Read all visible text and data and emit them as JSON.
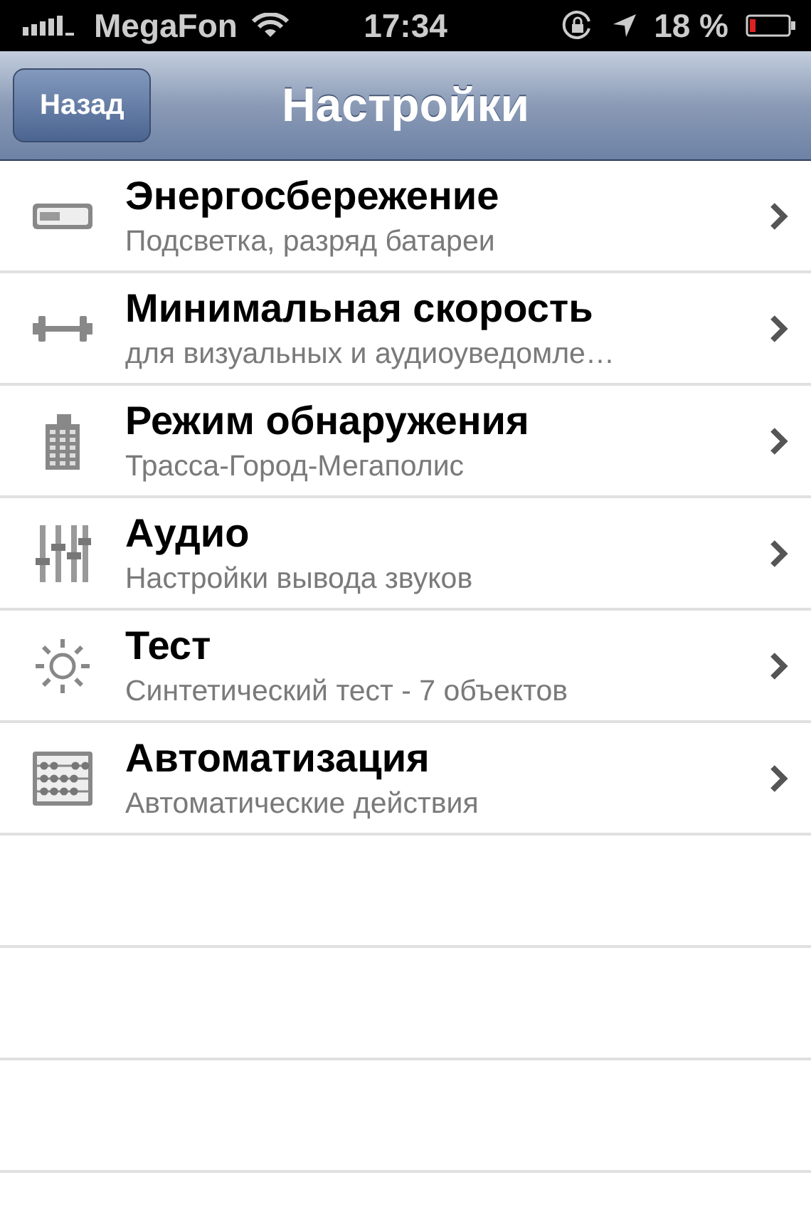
{
  "status_bar": {
    "carrier": "MegaFon",
    "time": "17:34",
    "battery_percent": "18 %"
  },
  "nav_bar": {
    "back": "Назад",
    "title": "Настройки"
  },
  "items": [
    {
      "title": "Энергосбережение",
      "subtitle": "Подсветка, разряд батареи"
    },
    {
      "title": "Минимальная скорость",
      "subtitle": "для визуальных и аудиоуведомле…"
    },
    {
      "title": "Режим обнаружения",
      "subtitle": "Трасса-Город-Мегаполис"
    },
    {
      "title": "Аудио",
      "subtitle": "Настройки вывода звуков"
    },
    {
      "title": "Тест",
      "subtitle": "Синтетический тест - 7 объектов"
    },
    {
      "title": "Автоматизация",
      "subtitle": "Автоматические действия"
    }
  ]
}
